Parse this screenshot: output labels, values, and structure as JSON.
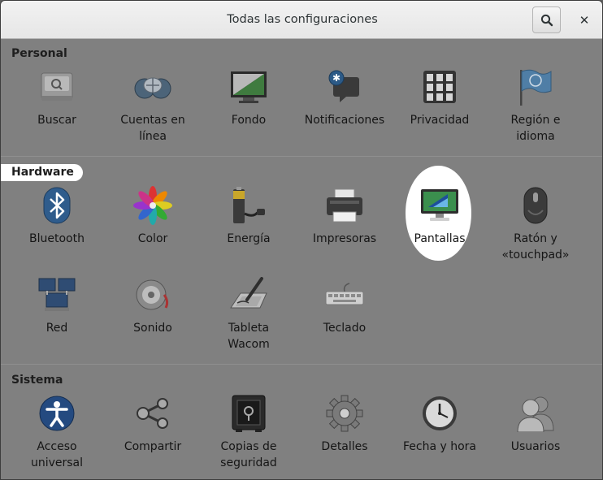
{
  "window": {
    "title": "Todas las configuraciones",
    "search_icon": "search-icon",
    "close_icon": "close-icon",
    "close_glyph": "✕"
  },
  "sections": {
    "personal": {
      "label": "Personal",
      "items": [
        {
          "label": "Buscar",
          "icon": "search-panel-icon"
        },
        {
          "label": "Cuentas en\nlínea",
          "icon": "online-accounts-icon"
        },
        {
          "label": "Fondo",
          "icon": "background-icon"
        },
        {
          "label": "Notificaciones",
          "icon": "notifications-icon"
        },
        {
          "label": "Privacidad",
          "icon": "privacy-icon"
        },
        {
          "label": "Región e\nidioma",
          "icon": "region-flag-icon"
        }
      ]
    },
    "hardware": {
      "label": "Hardware",
      "items": [
        {
          "label": "Bluetooth",
          "icon": "bluetooth-icon"
        },
        {
          "label": "Color",
          "icon": "color-icon"
        },
        {
          "label": "Energía",
          "icon": "power-battery-icon"
        },
        {
          "label": "Impresoras",
          "icon": "printer-icon"
        },
        {
          "label": "Pantallas",
          "icon": "display-icon"
        },
        {
          "label": "Ratón y\n«touchpad»",
          "icon": "mouse-icon"
        },
        {
          "label": "Red",
          "icon": "network-icon"
        },
        {
          "label": "Sonido",
          "icon": "sound-icon"
        },
        {
          "label": "Tableta\nWacom",
          "icon": "wacom-tablet-icon"
        },
        {
          "label": "Teclado",
          "icon": "keyboard-icon"
        }
      ]
    },
    "sistema": {
      "label": "Sistema",
      "items": [
        {
          "label": "Acceso\nuniversal",
          "icon": "universal-access-icon"
        },
        {
          "label": "Compartir",
          "icon": "sharing-icon"
        },
        {
          "label": "Copias de\nseguridad",
          "icon": "backup-safe-icon"
        },
        {
          "label": "Detalles",
          "icon": "details-gear-icon"
        },
        {
          "label": "Fecha y hora",
          "icon": "clock-icon"
        },
        {
          "label": "Usuarios",
          "icon": "users-icon"
        }
      ]
    }
  }
}
